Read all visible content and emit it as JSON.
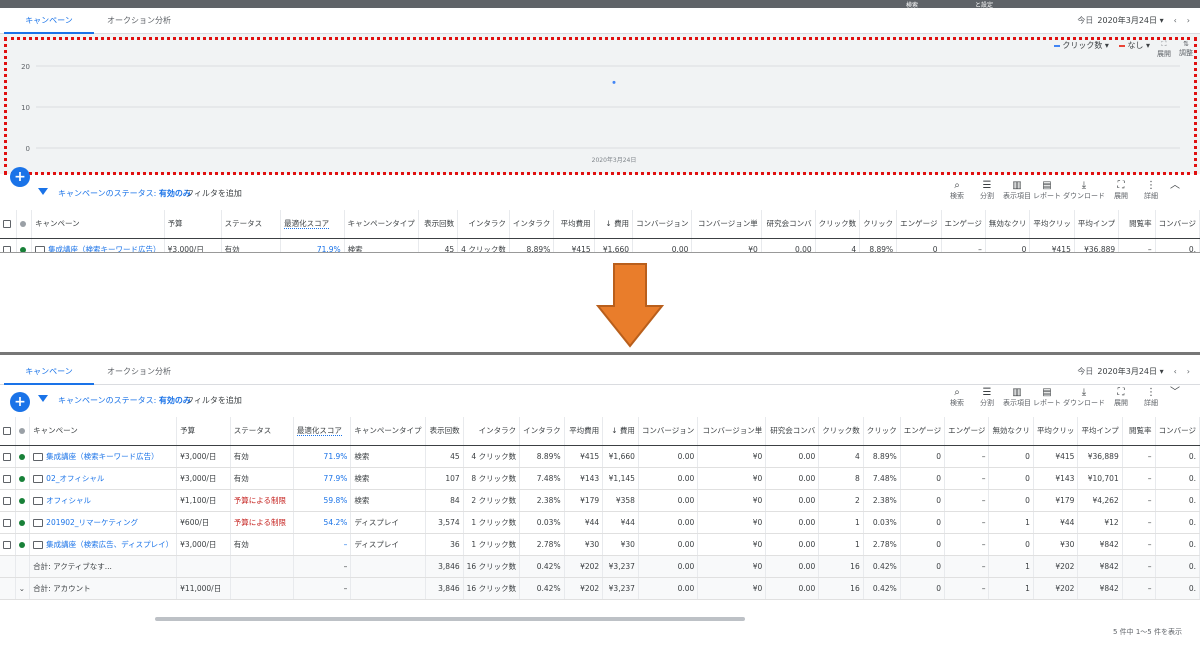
{
  "top_strip": {
    "text1": "検索",
    "text2": "と設定"
  },
  "tabs": [
    {
      "label": "キャンペーン"
    },
    {
      "label": "オークション分析"
    }
  ],
  "date": {
    "label": "今日",
    "value": "2020年3月24日"
  },
  "chart_legend": {
    "metric1": "クリック数",
    "metric2": "なし",
    "expand": "展開",
    "adjust": "調整"
  },
  "chart_data": {
    "type": "scatter",
    "x": [
      "2020年3月24日"
    ],
    "series": [
      {
        "name": "クリック数",
        "values": [
          16
        ]
      }
    ],
    "ylim": [
      0,
      20
    ],
    "yticks": [
      "0",
      "10",
      "20"
    ],
    "xlabel": "2020年3月24日",
    "ylabel": "",
    "colors": {
      "series": "#4285f4"
    }
  },
  "filter": {
    "prefix": "キャンペーンのステータス:",
    "value": "有効のみ",
    "add": "フィルタを追加"
  },
  "tools": [
    "検索",
    "分割",
    "表示項目",
    "レポート",
    "ダウンロード",
    "展開",
    "詳細"
  ],
  "columns": [
    "",
    "",
    "キャンペーン",
    "予算",
    "ステータス",
    "最適化スコア",
    "キャンペーンタイプ",
    "表示回数",
    "インタラク",
    "インタラク",
    "平均費用",
    "費用",
    "コンバージョン",
    "コンバージョン単",
    "研究会コンバ",
    "クリック数",
    "クリック",
    "エンゲージ",
    "エンゲージ",
    "無効なクリ",
    "平均クリッ",
    "平均インプ",
    "閲覧率",
    "コンバージ"
  ],
  "rows": [
    {
      "name": "集成講座（検索キーワード広告）",
      "budget": "¥3,000/日",
      "status": "有効",
      "score": "71.9%",
      "type": "検索",
      "imp": "45",
      "inter": "4 クリック数",
      "rate": "8.89%",
      "avg": "¥415",
      "cost": "¥1,660",
      "conv": "0.00",
      "cpa": "¥0",
      "rc": "0.00",
      "clicks": "4",
      "ctr": "8.89%",
      "eng": "0",
      "engr": "–",
      "inv": "0",
      "cpc": "¥415",
      "cpm": "¥36,889",
      "view": "–",
      "cv": "0."
    },
    {
      "name": "02_オフィシャル",
      "budget": "¥3,000/日",
      "status": "有効",
      "score": "77.9%",
      "type": "検索",
      "imp": "107",
      "inter": "8 クリック数",
      "rate": "7.48%",
      "avg": "¥143",
      "cost": "¥1,145",
      "conv": "0.00",
      "cpa": "¥0",
      "rc": "0.00",
      "clicks": "8",
      "ctr": "7.48%",
      "eng": "0",
      "engr": "–",
      "inv": "0",
      "cpc": "¥143",
      "cpm": "¥10,701",
      "view": "–",
      "cv": "0."
    },
    {
      "name": "オフィシャル",
      "budget": "¥1,100/日",
      "status": "予算による制限",
      "score": "59.8%",
      "type": "検索",
      "imp": "84",
      "inter": "2 クリック数",
      "rate": "2.38%",
      "avg": "¥179",
      "cost": "¥358",
      "conv": "0.00",
      "cpa": "¥0",
      "rc": "0.00",
      "clicks": "2",
      "ctr": "2.38%",
      "eng": "0",
      "engr": "–",
      "inv": "0",
      "cpc": "¥179",
      "cpm": "¥4,262",
      "view": "–",
      "cv": "0."
    },
    {
      "name": "201902_リマーケティング",
      "budget": "¥600/日",
      "status": "予算による制限",
      "score": "54.2%",
      "type": "ディスプレイ",
      "imp": "3,574",
      "inter": "1 クリック数",
      "rate": "0.03%",
      "avg": "¥44",
      "cost": "¥44",
      "conv": "0.00",
      "cpa": "¥0",
      "rc": "0.00",
      "clicks": "1",
      "ctr": "0.03%",
      "eng": "0",
      "engr": "–",
      "inv": "1",
      "cpc": "¥44",
      "cpm": "¥12",
      "view": "–",
      "cv": "0."
    },
    {
      "name": "集成講座（検索広告、ディスプレイ）",
      "budget": "¥3,000/日",
      "status": "有効",
      "score": "–",
      "type": "ディスプレイ",
      "imp": "36",
      "inter": "1 クリック数",
      "rate": "2.78%",
      "avg": "¥30",
      "cost": "¥30",
      "conv": "0.00",
      "cpa": "¥0",
      "rc": "0.00",
      "clicks": "1",
      "ctr": "2.78%",
      "eng": "0",
      "engr": "–",
      "inv": "0",
      "cpc": "¥30",
      "cpm": "¥842",
      "view": "–",
      "cv": "0."
    }
  ],
  "totals": [
    {
      "label": "合計: アクティブなす...",
      "budget": "",
      "score": "–",
      "imp": "3,846",
      "inter": "16 クリック数",
      "rate": "0.42%",
      "avg": "¥202",
      "cost": "¥3,237",
      "conv": "0.00",
      "cpa": "¥0",
      "rc": "0.00",
      "clicks": "16",
      "ctr": "0.42%",
      "eng": "0",
      "engr": "–",
      "inv": "1",
      "cpc": "¥202",
      "cpm": "¥842",
      "view": "–",
      "cv": "0."
    },
    {
      "label": "合計: アカウント",
      "budget": "¥11,000/日",
      "score": "–",
      "imp": "3,846",
      "inter": "16 クリック数",
      "rate": "0.42%",
      "avg": "¥202",
      "cost": "¥3,237",
      "conv": "0.00",
      "cpa": "¥0",
      "rc": "0.00",
      "clicks": "16",
      "ctr": "0.42%",
      "eng": "0",
      "engr": "–",
      "inv": "1",
      "cpc": "¥202",
      "cpm": "¥842",
      "view": "–",
      "cv": "0."
    }
  ],
  "pager": "5 件中 1～5 件を表示",
  "colors": {
    "accent": "#1a73e8",
    "red_box": "#e01010",
    "arrow": "#e97d2b"
  }
}
